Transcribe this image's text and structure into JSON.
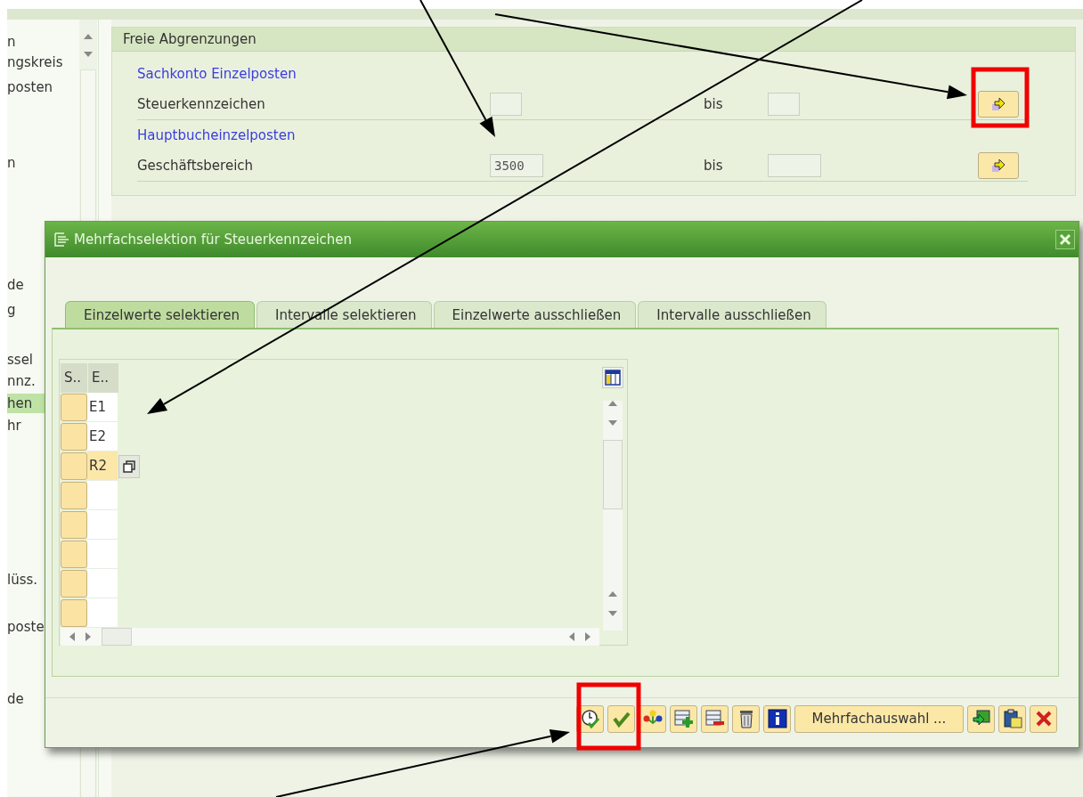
{
  "sidebar": {
    "items": [
      {
        "label": "n",
        "selected": false
      },
      {
        "label": "ngskreis",
        "selected": false
      },
      {
        "label": "posten",
        "selected": false
      },
      {
        "label": "n",
        "selected": false
      },
      {
        "label": "de",
        "selected": false
      },
      {
        "label": "g",
        "selected": false
      },
      {
        "label": "ssel",
        "selected": false
      },
      {
        "label": "nnz.",
        "selected": false
      },
      {
        "label": "hen",
        "selected": true
      },
      {
        "label": "hr",
        "selected": false
      },
      {
        "label": "lüss.",
        "selected": false
      },
      {
        "label": "poste",
        "selected": false
      },
      {
        "label": "de",
        "selected": false
      }
    ]
  },
  "panel": {
    "title": "Freie Abgrenzungen",
    "groups": [
      {
        "heading": "Sachkonto Einzelposten",
        "rows": [
          {
            "label": "Steuerkennzeichen",
            "to_label": "bis"
          }
        ]
      },
      {
        "heading": "Hauptbucheinzelposten",
        "rows": [
          {
            "label": "Geschäftsbereich",
            "value": "3500",
            "to_label": "bis"
          }
        ]
      }
    ]
  },
  "dialog": {
    "title": "Mehrfachselektion für Steuerkennzeichen",
    "tabs": [
      {
        "label": "Einzelwerte selektieren",
        "selected": true
      },
      {
        "label": "Intervalle selektieren",
        "selected": false
      },
      {
        "label": "Einzelwerte ausschließen",
        "selected": false
      },
      {
        "label": "Intervalle ausschließen",
        "selected": false
      }
    ],
    "table": {
      "columns": [
        "S..",
        "E.."
      ],
      "rows": [
        {
          "value": "E1",
          "focused": false
        },
        {
          "value": "E2",
          "focused": false
        },
        {
          "value": "R2",
          "focused": true
        },
        {
          "focused": false
        },
        {
          "focused": false
        },
        {
          "focused": false
        },
        {
          "focused": false
        },
        {
          "focused": false
        }
      ]
    },
    "toolbar": [
      {
        "kind": "execute"
      },
      {
        "kind": "check"
      },
      {
        "kind": "hierarchy"
      },
      {
        "kind": "insert"
      },
      {
        "kind": "remove"
      },
      {
        "kind": "trash"
      },
      {
        "kind": "info"
      },
      {
        "kind": "text",
        "label": "Mehrfachauswahl ..."
      },
      {
        "kind": "import"
      },
      {
        "kind": "paste"
      },
      {
        "kind": "cancel"
      }
    ]
  }
}
